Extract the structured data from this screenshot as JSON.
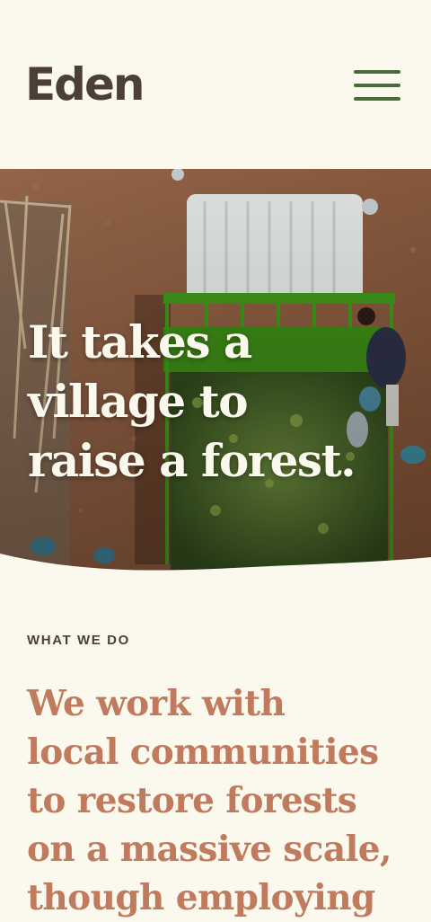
{
  "header": {
    "logo_text": "Eden",
    "menu_icon": "hamburger-menu-icon",
    "menu_color": "#4a6b3a"
  },
  "hero": {
    "headline_lines": [
      "It takes a",
      "village to",
      "raise a forest."
    ]
  },
  "section": {
    "eyebrow": "WHAT WE DO",
    "mission_lines": [
      "We work with",
      "local communities",
      "to restore forests",
      "on a massive scale,",
      "though employing"
    ]
  },
  "colors": {
    "background": "#fbf8ed",
    "logo": "#4b3f38",
    "accent": "#c07b5e",
    "hero_text": "#fbf8ed"
  }
}
